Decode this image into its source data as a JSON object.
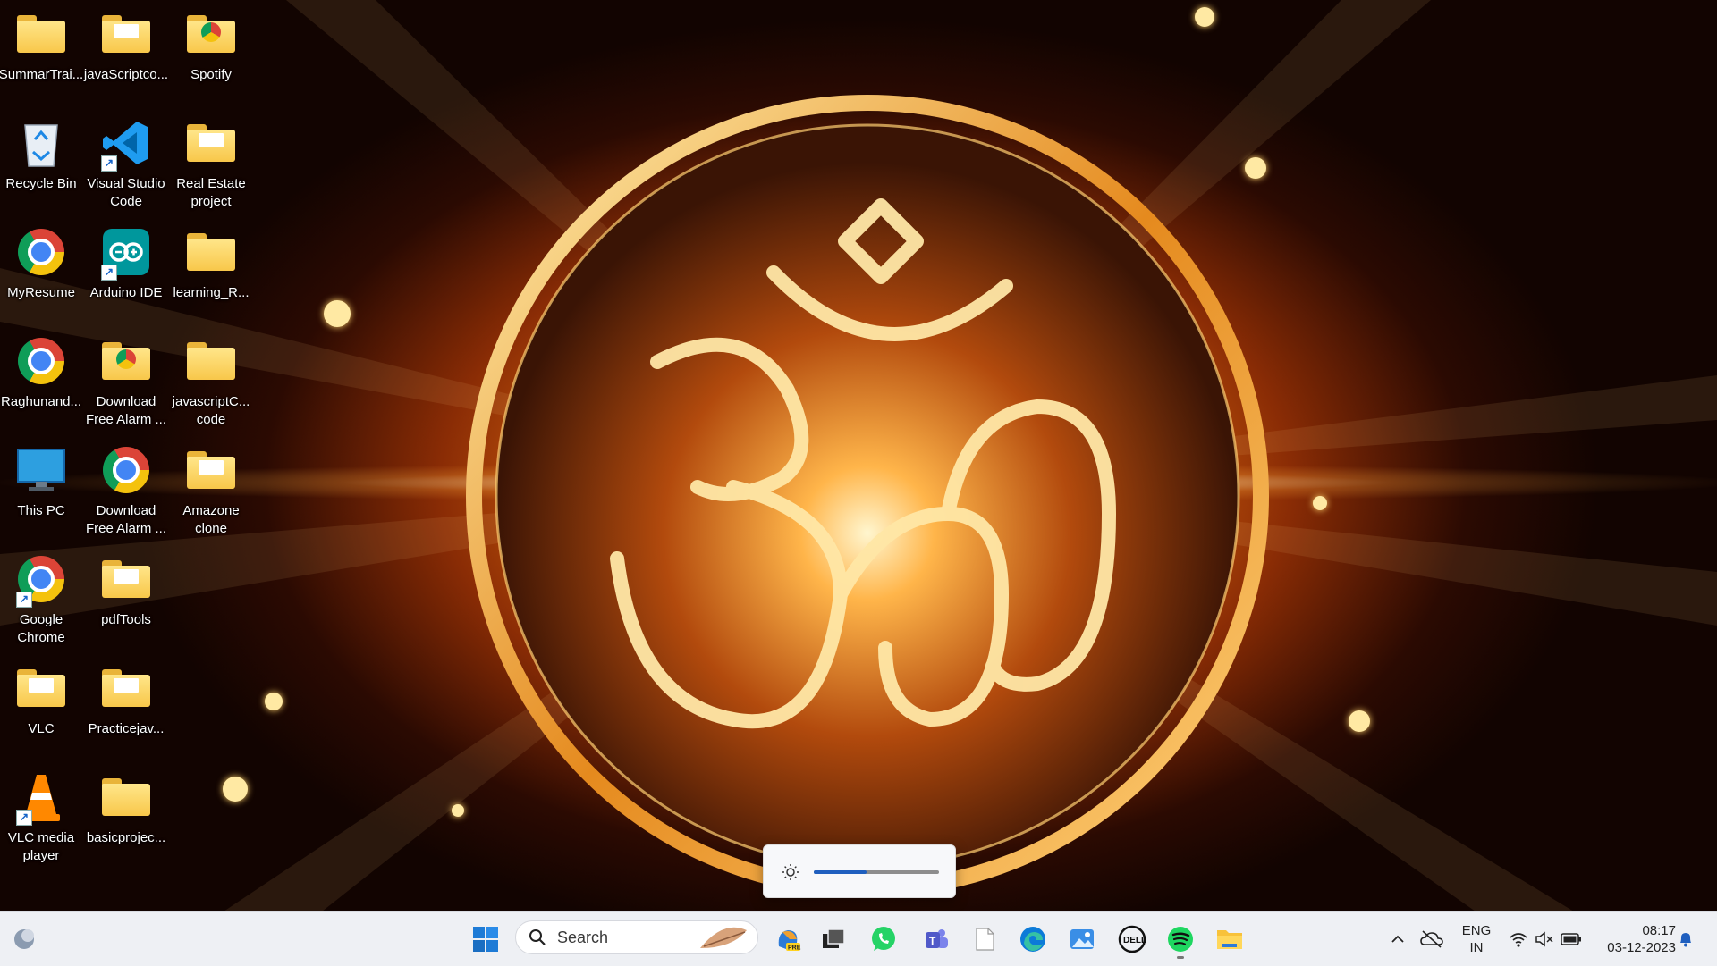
{
  "desktop": {
    "icons": [
      {
        "label": "SummarTrai...",
        "kind": "folder"
      },
      {
        "label": "javaScriptco...",
        "kind": "folder-doc"
      },
      {
        "label": "Spotify",
        "kind": "folder-chrome"
      },
      {
        "label": "Recycle Bin",
        "kind": "recycle"
      },
      {
        "label": "Visual Studio Code",
        "kind": "vscode"
      },
      {
        "label": "Real Estate project",
        "kind": "folder-doc"
      },
      {
        "label": "MyResume",
        "kind": "chrome"
      },
      {
        "label": "Arduino IDE",
        "kind": "arduino"
      },
      {
        "label": "learning_R...",
        "kind": "folder"
      },
      {
        "label": "Raghunand...",
        "kind": "chrome"
      },
      {
        "label": "Download Free Alarm ...",
        "kind": "folder-chrome"
      },
      {
        "label": "javascriptC... code",
        "kind": "folder"
      },
      {
        "label": "This PC",
        "kind": "pc"
      },
      {
        "label": "Download Free Alarm ...",
        "kind": "chrome"
      },
      {
        "label": "Amazone clone",
        "kind": "folder-doc"
      },
      {
        "label": "Google Chrome",
        "kind": "chrome-shortcut"
      },
      {
        "label": "pdfTools",
        "kind": "folder-doc"
      },
      {
        "label": "VLC",
        "kind": "folder-vlc"
      },
      {
        "label": "Practicejav...",
        "kind": "folder-doc"
      },
      {
        "label": "VLC media player",
        "kind": "vlc"
      },
      {
        "label": "basicprojec...",
        "kind": "folder"
      }
    ]
  },
  "brightness_flyout": {
    "icon": "sun-icon",
    "level": 0.42
  },
  "taskbar": {
    "search_placeholder": "Search",
    "apps": [
      "windows-start",
      "copilot-pre",
      "task-view",
      "whatsapp",
      "teams",
      "notepad",
      "edge",
      "photos",
      "dell",
      "spotify",
      "file-explorer"
    ],
    "tray": {
      "lang_line1": "ENG",
      "lang_line2": "IN",
      "time": "08:17",
      "date": "03-12-2023"
    }
  },
  "colors": {
    "accent": "#1f5fbf",
    "taskbar_bg": "#eef0f4"
  }
}
